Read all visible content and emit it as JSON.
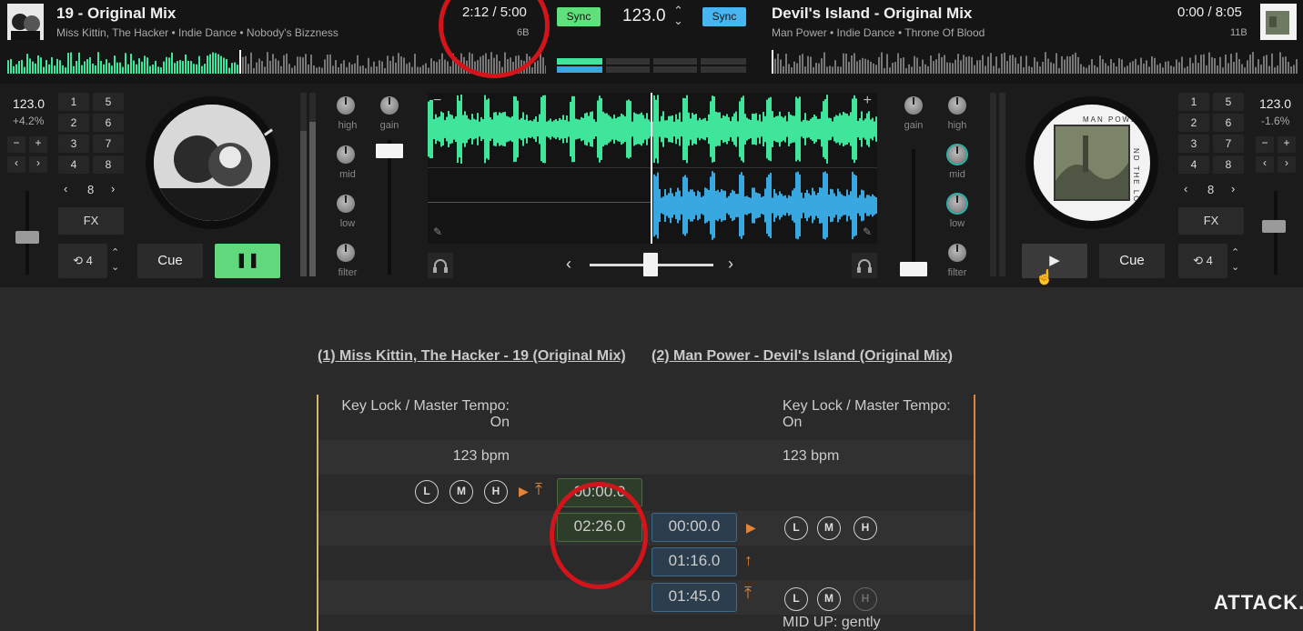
{
  "deck_a": {
    "title": "19 - Original Mix",
    "meta": "Miss Kittin, The Hacker • Indie Dance • Nobody's Bizzness",
    "time": "2:12 / 5:00",
    "key": "6B",
    "sync_label": "Sync",
    "bpm": "123.0",
    "pitch": "+4.2%",
    "hotcues": [
      "1",
      "5",
      "2",
      "6",
      "3",
      "7",
      "4",
      "8"
    ],
    "loop_size": "8",
    "fx_label": "FX",
    "loop_label": "4",
    "cue_label": "Cue",
    "play_symbol": "❚❚"
  },
  "deck_b": {
    "title": "Devil's Island - Original Mix",
    "meta": "Man Power • Indie Dance • Throne Of Blood",
    "time": "0:00 / 8:05",
    "key": "11B",
    "sync_label": "Sync",
    "bpm": "123.0",
    "pitch": "-1.6%",
    "hotcues": [
      "1",
      "5",
      "2",
      "6",
      "3",
      "7",
      "4",
      "8"
    ],
    "loop_size": "8",
    "fx_label": "FX",
    "loop_label": "4",
    "cue_label": "Cue",
    "play_symbol": "▶",
    "art_text": "MAN POWER",
    "art_side_text": "ND THE LOOP"
  },
  "master_bpm": "123.0",
  "mixer": {
    "left_knobs": [
      "high",
      "mid",
      "low",
      "filter"
    ],
    "right_knobs": [
      "high",
      "mid",
      "low",
      "filter"
    ],
    "gain_label": "gain"
  },
  "colors": {
    "green": "#3ee59a",
    "blue": "#3aa8e0",
    "sync_green": "#5fe07a",
    "sync_blue": "#49b5f0",
    "orange": "#e0843a",
    "red_ring": "#d3141b"
  },
  "notes": {
    "track1": "(1) Miss Kittin, The Hacker - 19 (Original Mix)",
    "track2": "(2) Man Power - Devil's Island (Original Mix)",
    "keylock_a": "Key Lock / Master Tempo: On",
    "keylock_b": "Key Lock / Master Tempo: On",
    "bpm_a": "123 bpm",
    "bpm_b": "123 bpm",
    "cue_a1": "00:00.0",
    "cue_a2": "02:26.0",
    "cue_b1": "00:00.0",
    "cue_b2": "01:16.0",
    "cue_b3": "01:45.0",
    "eq_labels": [
      "L",
      "M",
      "H"
    ],
    "mid_up": "MID UP: gently"
  },
  "watermark": "ATTACK."
}
